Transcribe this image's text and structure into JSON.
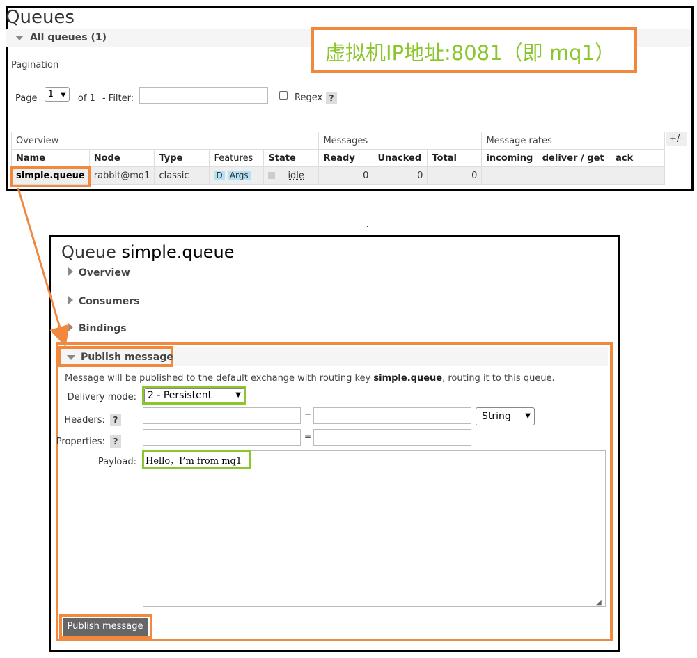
{
  "queues": {
    "title": "Queues",
    "all_queues_label": "All queues (1)",
    "pagination_label": "Pagination",
    "page_label": "Page",
    "page_value": "1",
    "of_label": "of 1",
    "filter_label": "- Filter:",
    "filter_value": "",
    "regex_label": "Regex",
    "help_glyph": "?",
    "plus_minus": "+/-",
    "group_headers": {
      "overview": "Overview",
      "messages": "Messages",
      "message_rates": "Message rates"
    },
    "columns": [
      "Name",
      "Node",
      "Type",
      "Features",
      "State",
      "Ready",
      "Unacked",
      "Total",
      "incoming",
      "deliver / get",
      "ack"
    ],
    "rows": [
      {
        "name": "simple.queue",
        "node": "rabbit@mq1",
        "type": "classic",
        "feature_tags": [
          "D",
          "Args"
        ],
        "state": "idle",
        "ready": "0",
        "unacked": "0",
        "total": "0",
        "incoming": "",
        "deliver_get": "",
        "ack": ""
      }
    ]
  },
  "annotation": {
    "ip_text": "虚拟机IP地址:8081（即 mq1）",
    "colors": {
      "orange": "#f0883e",
      "green": "#8ac62c"
    }
  },
  "queue_detail": {
    "title_prefix": "Queue",
    "queue_name": "simple.queue",
    "sections": [
      "Overview",
      "Consumers",
      "Bindings"
    ],
    "publish": {
      "title": "Publish message",
      "intro_pre": "Message will be published to the default exchange with routing key ",
      "intro_key": "simple.queue",
      "intro_post": ", routing it to this queue.",
      "delivery_label": "Delivery mode:",
      "delivery_value": "2 - Persistent",
      "headers_label": "Headers:",
      "properties_label": "Properties:",
      "equals": "=",
      "header_type": "String",
      "payload_label": "Payload:",
      "payload_value": "Hello，I’m from mq1",
      "button_label": "Publish message"
    }
  }
}
